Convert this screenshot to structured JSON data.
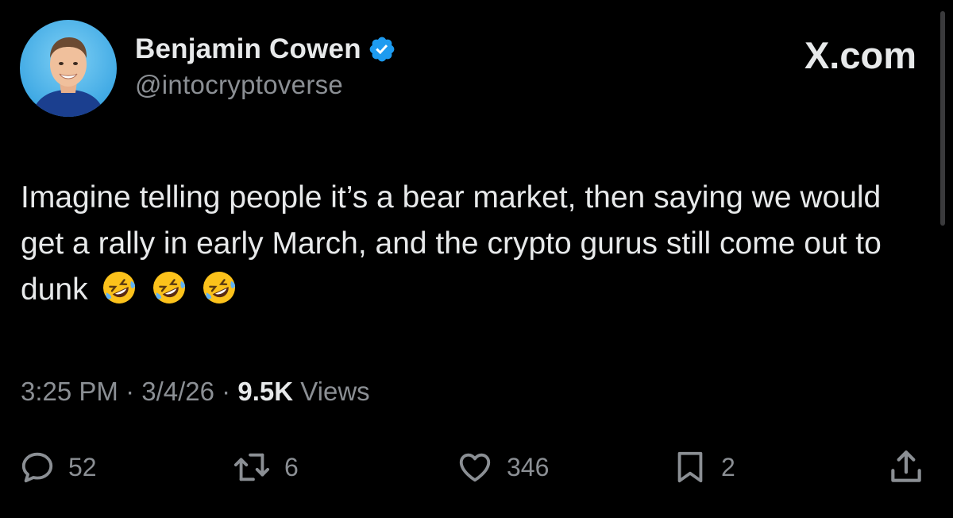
{
  "author": {
    "display_name": "Benjamin Cowen",
    "handle": "@intocryptoverse",
    "verified": true
  },
  "brand": {
    "label": "X.com"
  },
  "tweet": {
    "text": "Imagine telling people it’s a bear market, then saying we would get a rally in early March, and the crypto gurus still come out to dunk",
    "emojis": [
      "rolling-on-floor-laughing-emoji",
      "rolling-on-floor-laughing-emoji",
      "rolling-on-floor-laughing-emoji"
    ]
  },
  "meta": {
    "time": "3:25 PM",
    "separator": "·",
    "date": "3/4/26",
    "views_count": "9.5K",
    "views_label": "Views"
  },
  "actions": {
    "replies": "52",
    "reposts": "6",
    "likes": "346",
    "bookmarks": "2"
  },
  "colors": {
    "background": "#000000",
    "text_primary": "#e7e9ea",
    "text_secondary": "#8b8f94",
    "verified_blue": "#1d9bf0"
  },
  "icons": [
    "reply-icon",
    "repost-icon",
    "like-icon",
    "bookmark-icon",
    "share-icon",
    "verified-badge-icon"
  ]
}
